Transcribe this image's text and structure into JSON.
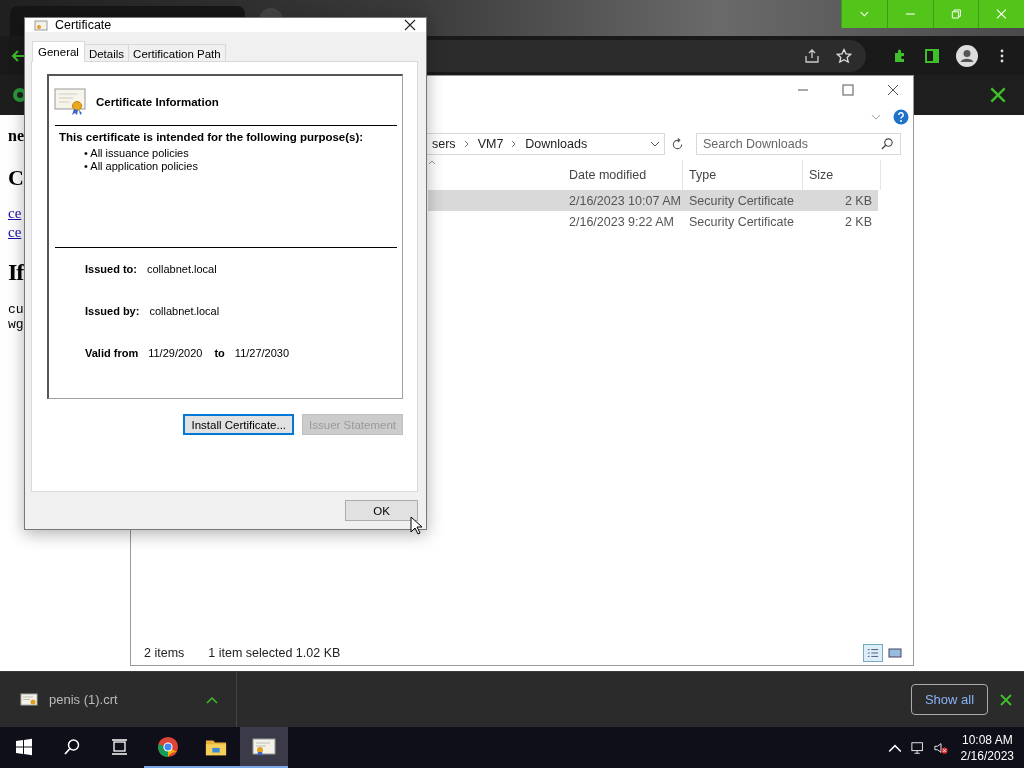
{
  "page": {
    "texts": [
      {
        "kind": "bold",
        "text": "ne"
      },
      {
        "kind": "heading",
        "text": "C"
      },
      {
        "kind": "link",
        "text": "ce"
      },
      {
        "kind": "link",
        "text": "ce"
      },
      {
        "kind": "title",
        "text": "If"
      },
      {
        "kind": "code",
        "text": "cu"
      },
      {
        "kind": "code",
        "text": "wg"
      }
    ]
  },
  "explorer": {
    "breadcrumb": [
      "sers",
      "VM7",
      "Downloads"
    ],
    "search": {
      "placeholder": "Search Downloads"
    },
    "columns": [
      "Date modified",
      "Type",
      "Size"
    ],
    "rows": [
      {
        "selected": true,
        "date": "2/16/2023 10:07 AM",
        "type": "Security Certificate",
        "size": "2 KB"
      },
      {
        "selected": false,
        "date": "2/16/2023 9:22 AM",
        "type": "Security Certificate",
        "size": "2 KB"
      }
    ],
    "status": {
      "count": "2 items",
      "selection": "1 item selected  1.02 KB"
    }
  },
  "dialog": {
    "title": "Certificate",
    "tabs": [
      {
        "label": "General",
        "selected": true
      },
      {
        "label": "Details",
        "selected": false
      },
      {
        "label": "Certification Path",
        "selected": false
      }
    ],
    "heading": "Certificate Information",
    "purpose_title": "This certificate is intended for the following purpose(s):",
    "purposes": [
      "• All issuance policies",
      "• All application policies"
    ],
    "issued_to": {
      "label": "Issued to:",
      "value": "collabnet.local"
    },
    "issued_by": {
      "label": "Issued by:",
      "value": "collabnet.local"
    },
    "valid": {
      "label": "Valid from",
      "from": "11/29/2020",
      "to_label": "to",
      "to": "11/27/2030"
    },
    "buttons": [
      {
        "label": "Install Certificate...",
        "disabled": false
      },
      {
        "label": "Issuer Statement",
        "disabled": true
      }
    ],
    "ok": "OK"
  },
  "downloads": {
    "file": "penis (1).crt",
    "show_all": "Show all"
  },
  "taskbar": {
    "apps": [
      {
        "kind": "chrome",
        "selected": false
      },
      {
        "kind": "folder",
        "selected": false
      },
      {
        "kind": "certificate",
        "selected": true
      }
    ],
    "time": "10:08 AM",
    "date": "2/16/2023"
  }
}
